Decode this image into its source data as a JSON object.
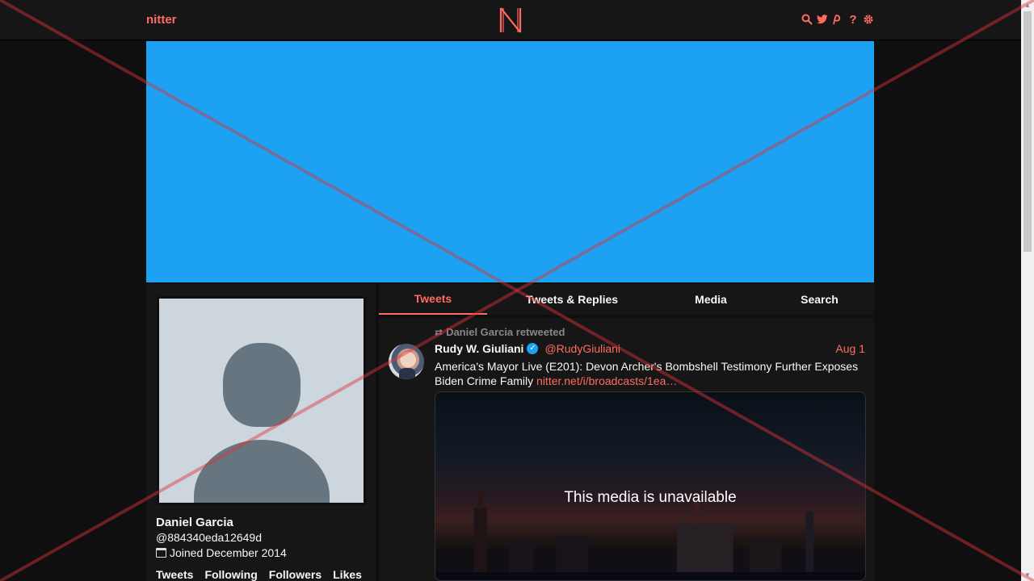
{
  "nav": {
    "brand": "nitter",
    "icons": [
      "search-icon",
      "twitter-bird-icon",
      "rss-icon",
      "help-icon",
      "gear-icon"
    ]
  },
  "profile": {
    "name": "Daniel Garcia",
    "handle": "@884340eda12649d",
    "joined": "Joined December 2014",
    "stats": [
      "Tweets",
      "Following",
      "Followers",
      "Likes"
    ]
  },
  "tabs": [
    {
      "label": "Tweets",
      "active": true
    },
    {
      "label": "Tweets & Replies",
      "active": false
    },
    {
      "label": "Media",
      "active": false
    },
    {
      "label": "Search",
      "active": false
    }
  ],
  "tweet": {
    "retweet_label": "Daniel Garcia retweeted",
    "author_name": "Rudy W. Giuliani",
    "author_handle": "@RudyGiuliani",
    "date": "Aug 1",
    "text": "America's Mayor Live (E201): Devon Archer's Bombshell Testimony Further Exposes Biden Crime Family ",
    "link": "nitter.net/i/broadcasts/1ea…",
    "media_message": "This media is unavailable"
  },
  "colors": {
    "accent": "#ff6c60",
    "banner": "#1da1f2",
    "background": "#0f0f0f",
    "panel": "#161616"
  }
}
